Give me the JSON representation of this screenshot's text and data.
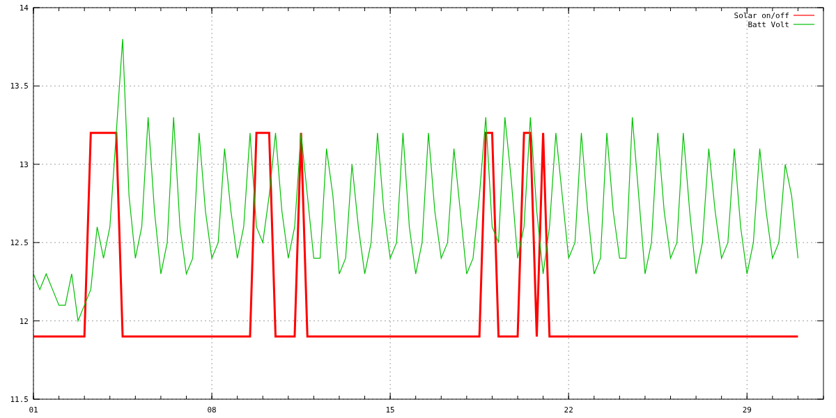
{
  "chart_data": {
    "type": "line",
    "legend": true,
    "grid": true,
    "xlim": [
      1,
      32
    ],
    "ylim": [
      11.5,
      14
    ],
    "xticks": [
      {
        "value": 1,
        "label": "01"
      },
      {
        "value": 8,
        "label": "08"
      },
      {
        "value": 15,
        "label": "15"
      },
      {
        "value": 22,
        "label": "22"
      },
      {
        "value": 29,
        "label": "29"
      }
    ],
    "yticks": [
      {
        "value": 11.5,
        "label": "11.5"
      },
      {
        "value": 12,
        "label": "12"
      },
      {
        "value": 12.5,
        "label": "12.5"
      },
      {
        "value": 13,
        "label": "13"
      },
      {
        "value": 13.5,
        "label": "13.5"
      },
      {
        "value": 14,
        "label": "14"
      }
    ],
    "x": [
      1,
      1.25,
      1.5,
      1.75,
      2,
      2.25,
      2.5,
      2.75,
      3,
      3.25,
      3.5,
      3.75,
      4,
      4.25,
      4.5,
      4.75,
      5,
      5.25,
      5.5,
      5.75,
      6,
      6.25,
      6.5,
      6.75,
      7,
      7.25,
      7.5,
      7.75,
      8,
      8.25,
      8.5,
      8.75,
      9,
      9.25,
      9.5,
      9.75,
      10,
      10.25,
      10.5,
      10.75,
      11,
      11.25,
      11.5,
      11.75,
      12,
      12.25,
      12.5,
      12.75,
      13,
      13.25,
      13.5,
      13.75,
      14,
      14.25,
      14.5,
      14.75,
      15,
      15.25,
      15.5,
      15.75,
      16,
      16.25,
      16.5,
      16.75,
      17,
      17.25,
      17.5,
      17.75,
      18,
      18.25,
      18.5,
      18.75,
      19,
      19.25,
      19.5,
      19.75,
      20,
      20.25,
      20.5,
      20.75,
      21,
      21.25,
      21.5,
      21.75,
      22,
      22.25,
      22.5,
      22.75,
      23,
      23.25,
      23.5,
      23.75,
      24,
      24.25,
      24.5,
      24.75,
      25,
      25.25,
      25.5,
      25.75,
      26,
      26.25,
      26.5,
      26.75,
      27,
      27.25,
      27.5,
      27.75,
      28,
      28.25,
      28.5,
      28.75,
      29,
      29.25,
      29.5,
      29.75,
      30,
      30.25,
      30.5,
      30.75,
      31
    ],
    "series": [
      {
        "name": "Solar on/off",
        "color": "#ff0000",
        "values": [
          11.9,
          11.9,
          11.9,
          11.9,
          11.9,
          11.9,
          11.9,
          11.9,
          11.9,
          13.2,
          13.2,
          13.2,
          13.2,
          13.2,
          11.9,
          11.9,
          11.9,
          11.9,
          11.9,
          11.9,
          11.9,
          11.9,
          11.9,
          11.9,
          11.9,
          11.9,
          11.9,
          11.9,
          11.9,
          11.9,
          11.9,
          11.9,
          11.9,
          11.9,
          11.9,
          13.2,
          13.2,
          13.2,
          11.9,
          11.9,
          11.9,
          11.9,
          13.2,
          11.9,
          11.9,
          11.9,
          11.9,
          11.9,
          11.9,
          11.9,
          11.9,
          11.9,
          11.9,
          11.9,
          11.9,
          11.9,
          11.9,
          11.9,
          11.9,
          11.9,
          11.9,
          11.9,
          11.9,
          11.9,
          11.9,
          11.9,
          11.9,
          11.9,
          11.9,
          11.9,
          11.9,
          13.2,
          13.2,
          11.9,
          11.9,
          11.9,
          11.9,
          13.2,
          13.2,
          11.9,
          13.2,
          11.9,
          11.9,
          11.9,
          11.9,
          11.9,
          11.9,
          11.9,
          11.9,
          11.9,
          11.9,
          11.9,
          11.9,
          11.9,
          11.9,
          11.9,
          11.9,
          11.9,
          11.9,
          11.9,
          11.9,
          11.9,
          11.9,
          11.9,
          11.9,
          11.9,
          11.9,
          11.9,
          11.9,
          11.9,
          11.9,
          11.9,
          11.9,
          11.9,
          11.9,
          11.9,
          11.9,
          11.9,
          11.9,
          11.9,
          11.9
        ]
      },
      {
        "name": "Batt Volt",
        "color": "#00c000",
        "values": [
          12.3,
          12.2,
          12.3,
          12.2,
          12.1,
          12.1,
          12.3,
          12.0,
          12.1,
          12.2,
          12.6,
          12.4,
          12.6,
          13.2,
          13.8,
          12.8,
          12.4,
          12.6,
          13.3,
          12.7,
          12.3,
          12.5,
          13.3,
          12.6,
          12.3,
          12.4,
          13.2,
          12.7,
          12.4,
          12.5,
          13.1,
          12.7,
          12.4,
          12.6,
          13.2,
          12.6,
          12.5,
          12.8,
          13.2,
          12.7,
          12.4,
          12.6,
          13.2,
          12.8,
          12.4,
          12.4,
          13.1,
          12.8,
          12.3,
          12.4,
          13.0,
          12.6,
          12.3,
          12.5,
          13.2,
          12.7,
          12.4,
          12.5,
          13.2,
          12.6,
          12.3,
          12.5,
          13.2,
          12.7,
          12.4,
          12.5,
          13.1,
          12.7,
          12.3,
          12.4,
          12.8,
          13.3,
          12.6,
          12.5,
          13.3,
          12.9,
          12.4,
          12.6,
          13.3,
          12.7,
          12.3,
          12.6,
          13.2,
          12.8,
          12.4,
          12.5,
          13.2,
          12.7,
          12.3,
          12.4,
          13.2,
          12.7,
          12.4,
          12.4,
          13.3,
          12.8,
          12.3,
          12.5,
          13.2,
          12.7,
          12.4,
          12.5,
          13.2,
          12.7,
          12.3,
          12.5,
          13.1,
          12.7,
          12.4,
          12.5,
          13.1,
          12.6,
          12.3,
          12.5,
          13.1,
          12.7,
          12.4,
          12.5,
          13.0,
          12.8,
          12.4
        ]
      }
    ]
  }
}
